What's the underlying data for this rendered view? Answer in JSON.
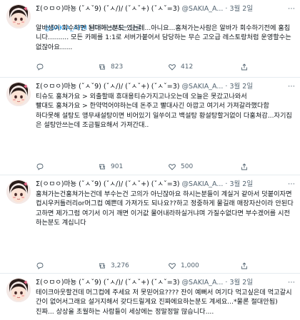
{
  "tweets": [
    {
      "author_name": "Σ(ㅇㅁㅇ)마뇽 (ˇㅅˇ9) (ˇㅅ/)/ (ˇㅅˇ+) (ˇㅅˇ=3)",
      "handle": "@SAKIA_A...",
      "separator": "·",
      "date": "3월 2일",
      "reply_prefix": "@SAKIA_ATM",
      "reply_suffix": " 님에게 보내는 답글",
      "text": "알바생이 회수하면 된다하는분도 있는데...아니요...홈쳐가는사람은 알바가 회수하기전에 훔칩니다.......... 모든 카페를 1:1로 서버가붙어서 담당하는 무슨 고오급 레스토랑처럼 운영할수는없잖아요......",
      "reply_count": "",
      "retweet_count": "823",
      "like_count": "412"
    },
    {
      "author_name": "Σ(ㅇㅁㅇ)마뇽 (ˇㅅˇ9) (ˇㅅ/)/ (ˇㅅˇ+) (ˇㅅˇ=3)",
      "handle": "@SAKIA_A...",
      "separator": "·",
      "date": "3월 2일",
      "text": "티슈도 훔쳐가요 > 외출할때 휴대용티슈가지고나오는데 오늘은 못갔고나와서\n빨대도 훔쳐가요 > 한약먹어야하는데 돈주고 빨대사긴 아깝고 여기서 가져갈라했다함\n하다못해 설탕도 앵무새설탕이면 비어있기 일쑤이고 백설탕 황설탕할거없이 다훔쳐감...자기집은 설탕안쓰는데 조금필요해서 가져간대..",
      "reply_count": "",
      "retweet_count": "901",
      "like_count": "500"
    },
    {
      "author_name": "Σ(ㅇㅁㅇ)마뇽 (ˇㅅˇ9) (ˇㅅ/)/ (ˇㅅˇ+) (ˇㅅˇ=3)",
      "handle": "@SAKIA_A...",
      "separator": "·",
      "date": "3월 2일",
      "text": "훔쳐가는건훔쳐가는건데 부수는건 고의가 아닌잖아요 하시는분들이 계실거 같아서 덧붙이자면 컵시우커틀러리or머그컵 예쁜데 가져가도 되나요??하고 정중하게 물길래 매장자산이라 안된다고하면 제가그럼 여기서 이거 깨면 이거값 물어내라하실거냐며 가질수없다면 부수겠어를 시전하는분도 계십니다",
      "reply_count": "",
      "retweet_count": "3,276",
      "like_count": "1,000"
    },
    {
      "author_name": "Σ(ㅇㅁㅇ)마뇽 (ˇㅅˇ9) (ˇㅅ/)/ (ˇㅅˇ+) (ˇㅅˇ=3)",
      "handle": "@SAKIA_A...",
      "separator": "·",
      "date": "3월 2일",
      "text": "테이크아웃할건데 머그컵에 주세요 저 못믿어요???? 잔이 예뻐서 여기다 먹고싶은데 먹고갈시간이 없어서그래요 설거지해서 갖다드릴게요 진짜에요하는분도 계세요...*물론 절대안됨)\n진짜... 상상을 초월하는 사람들이 세상에는 정말정말 많습니다....",
      "reply_count": "",
      "retweet_count": "",
      "like_count": ""
    }
  ]
}
